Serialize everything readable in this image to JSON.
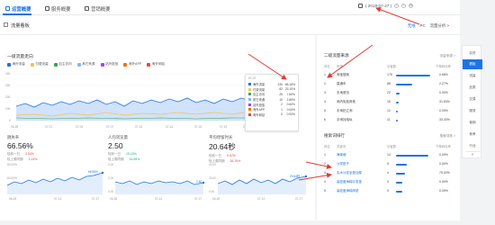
{
  "tabs": [
    {
      "label": "运营概要"
    },
    {
      "label": "服务概要"
    },
    {
      "label": "营销概要"
    }
  ],
  "date_range": "( 2018-07-27 )",
  "section_title": "流量看板",
  "section_controls": [
    "无线",
    "PC",
    "流量分析 >"
  ],
  "traffic_trend": {
    "title": "一级流量走向",
    "legend": [
      {
        "name": "海外流量",
        "color": "#1a73e8"
      },
      {
        "name": "付费流量",
        "color": "#f6c24b"
      },
      {
        "name": "自主访问",
        "color": "#34a853"
      },
      {
        "name": "其它来源",
        "color": "#8ab4f8"
      },
      {
        "name": "站外投放",
        "color": "#a142f4"
      },
      {
        "name": "淘外APP",
        "color": "#ff6d01"
      },
      {
        "name": "淘外网站",
        "color": "#e8453c"
      }
    ],
    "y_ticks": [
      "400",
      "300",
      "200",
      "100",
      "0"
    ],
    "x_ticks": [
      "06-28",
      "07-01",
      "07-04",
      "07-07",
      "07-10",
      "07-13",
      "07-16",
      "07-19",
      "07-22",
      "07-27"
    ]
  },
  "tooltip": {
    "date": "07-27",
    "rows": [
      {
        "name": "海外流量",
        "value": "230",
        "pct": "65.18%",
        "color": "#1a73e8"
      },
      {
        "name": "付费流量",
        "value": "82",
        "pct": "23.10%",
        "color": "#f6c24b"
      },
      {
        "name": "自主访问",
        "value": "25",
        "pct": "7.60%",
        "color": "#34a853"
      },
      {
        "name": "其它来源",
        "value": "10",
        "pct": "2.80%",
        "color": "#8ab4f8"
      },
      {
        "name": "站外投放",
        "value": "2",
        "pct": "0.60%",
        "color": "#a142f4"
      },
      {
        "name": "淘外APP",
        "value": "1",
        "pct": "0.00%",
        "color": "#ff6d01"
      },
      {
        "name": "淘外网站",
        "value": "0",
        "pct": "0.00%",
        "color": "#e8453c"
      }
    ]
  },
  "metrics": [
    {
      "label": "跳失率",
      "value": "66.56%",
      "cmp1": "较前一日",
      "cmp1v": "3.54%",
      "cmp2": "较上周同期",
      "cmp2v": "3.14%",
      "x_ticks": [
        "06-28",
        "07-14",
        "07-27"
      ],
      "y_ticks": [
        "80.00%",
        "60.00%",
        "40.00%"
      ],
      "peak": "66.56%"
    },
    {
      "label": "人均浏览量",
      "value": "2.50",
      "cmp1": "较前一日",
      "cmp1v": "15.15%",
      "cmp2": "较上周同期",
      "cmp2v": "16.55%",
      "x_ticks": [
        "06-28",
        "07-14",
        "07-27"
      ],
      "y_ticks": [
        "4.00",
        "2.00",
        "0.00"
      ],
      "peak": "2.50"
    },
    {
      "label": "平均停留时长",
      "value": "20.64秒",
      "cmp1": "较前一日",
      "cmp1v": "9.52%",
      "cmp2": "较上周同期",
      "cmp2v": "36.76%",
      "x_ticks": [
        "06-28",
        "07-14",
        "07-27"
      ],
      "y_ticks": [
        "40.00",
        "20.00",
        "0.00"
      ],
      "peak": "20.64秒"
    }
  ],
  "secondary_source": {
    "title": "二级流量来源",
    "link": "流量来源 >",
    "headers": [
      "排名",
      "来源",
      "访客数",
      "下单转化率"
    ],
    "rows": [
      {
        "rank": "1",
        "name": "淘宝搜索",
        "visitors": "176",
        "rate": "0.66%",
        "bar": 0.95
      },
      {
        "rank": "2",
        "name": "直通车",
        "visitors": "88",
        "rate": "2.27%",
        "bar": 0.45
      },
      {
        "rank": "3",
        "name": "手淘首页",
        "visitors": "22",
        "rate": "0.00%",
        "bar": 0.11
      },
      {
        "rank": "4",
        "name": "淘内免费其他",
        "visitors": "15",
        "rate": "31.53%",
        "bar": 0.07
      },
      {
        "rank": "5",
        "name": "手淘拍立淘",
        "visitors": "12",
        "rate": "0.00%",
        "bar": 0.05
      },
      {
        "rank": "6",
        "name": "手淘找相似",
        "visitors": "11",
        "rate": "33.33%",
        "bar": 0.04
      }
    ]
  },
  "keyword_rank": {
    "title": "搜索词排行",
    "link": "搜索词排 >",
    "headers": [
      "排名",
      "关键词",
      "访客数",
      "下单转化率"
    ],
    "rows": [
      {
        "rank": "1",
        "name": "海绵墙",
        "visitors": "14",
        "rate": "0.00%",
        "bar": 0.9
      },
      {
        "rank": "2",
        "name": "沙发垫子",
        "visitors": "5",
        "rate": "0.00%",
        "bar": 0.3
      },
      {
        "rank": "3",
        "name": "实木沙发坐垫加厚",
        "visitors": "4",
        "rate": "75.00%",
        "bar": 0.25
      },
      {
        "rank": "4",
        "name": "高密度海绵沙发垫",
        "visitors": "3",
        "rate": "0.00%",
        "bar": 0.18
      },
      {
        "rank": "5",
        "name": "高密度海绵床垫",
        "visitors": "3",
        "rate": "0.00%",
        "bar": 0.18
      }
    ]
  },
  "sidebar": [
    {
      "label": "实时"
    },
    {
      "label": "看板",
      "active": true
    },
    {
      "label": "流量"
    },
    {
      "label": "品类"
    },
    {
      "label": "交易"
    },
    {
      "label": "服务"
    },
    {
      "label": "营销"
    },
    {
      "label": "竞争"
    },
    {
      "label": "行业"
    }
  ],
  "sidebar_close": "Y"
}
